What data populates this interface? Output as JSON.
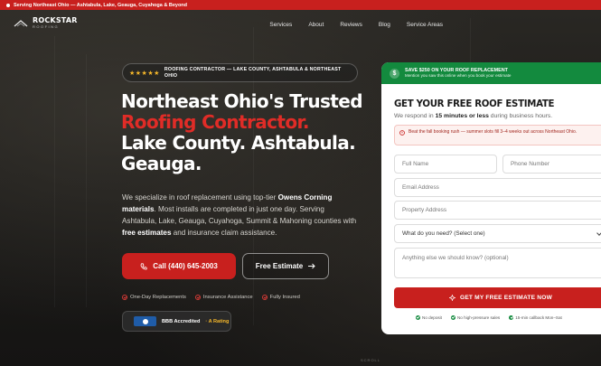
{
  "topbar": {
    "text": "Serving Northeast Ohio — Ashtabula, Lake, Geauga, Cuyahoga & Beyond"
  },
  "logo": {
    "title": "ROCKSTAR",
    "subtitle": "ROOFING"
  },
  "nav": {
    "items": [
      "Services",
      "About",
      "Reviews",
      "Blog",
      "Service Areas"
    ]
  },
  "hero": {
    "stars": "★★★★★",
    "badge_text": "ROOFING CONTRACTOR — LAKE COUNTY, ASHTABULA & NORTHEAST OHIO",
    "headline_line1": "Northeast Ohio's Trusted",
    "headline_line2": "Roofing Contractor.",
    "headline_line3": "Lake County. Ashtabula.",
    "headline_line4": "Geauga.",
    "lead_part1": "We specialize in roof replacement using top-tier ",
    "lead_bold1": "Owens Corning materials",
    "lead_part2": ". Most installs are completed in just one day. Serving Ashtabula, Lake, Geauga, Cuyahoga, Summit & Mahoning counties with ",
    "lead_bold2": "free estimates",
    "lead_part3": " and insurance claim assistance.",
    "call_button": "Call (440) 645-2003",
    "estimate_button": "Free Estimate",
    "trust": [
      "One-Day Replacements",
      "Insurance Assistance",
      "Fully Insured"
    ],
    "bbb_label": "BBB Accredited",
    "bbb_rating": "· A Rating",
    "scroll": "SCROLL"
  },
  "form": {
    "promo_title": "SAVE $250 ON YOUR ROOF REPLACEMENT",
    "promo_sub": "Mention you saw this online when you book your estimate",
    "title": "GET YOUR FREE ROOF ESTIMATE",
    "sub_part1": "We respond in ",
    "sub_bold": "15 minutes or less",
    "sub_part2": " during business hours.",
    "notice": "Beat the fall booking rush — summer slots fill 3–4 weeks out across Northeast Ohio.",
    "full_name": "Full Name",
    "phone": "Phone Number",
    "email": "Email Address",
    "address": "Property Address",
    "service_select": "What do you need? (Select one)",
    "message": "Anything else we should know? (optional)",
    "submit": "GET MY FREE ESTIMATE NOW",
    "guarantees": [
      "No deposit",
      "No high-pressure sales",
      "15-min callback Mon–Sat"
    ]
  },
  "colors": {
    "brand_red": "#c8201e",
    "promo_green": "#138a3e",
    "star_gold": "#f5b72a"
  }
}
